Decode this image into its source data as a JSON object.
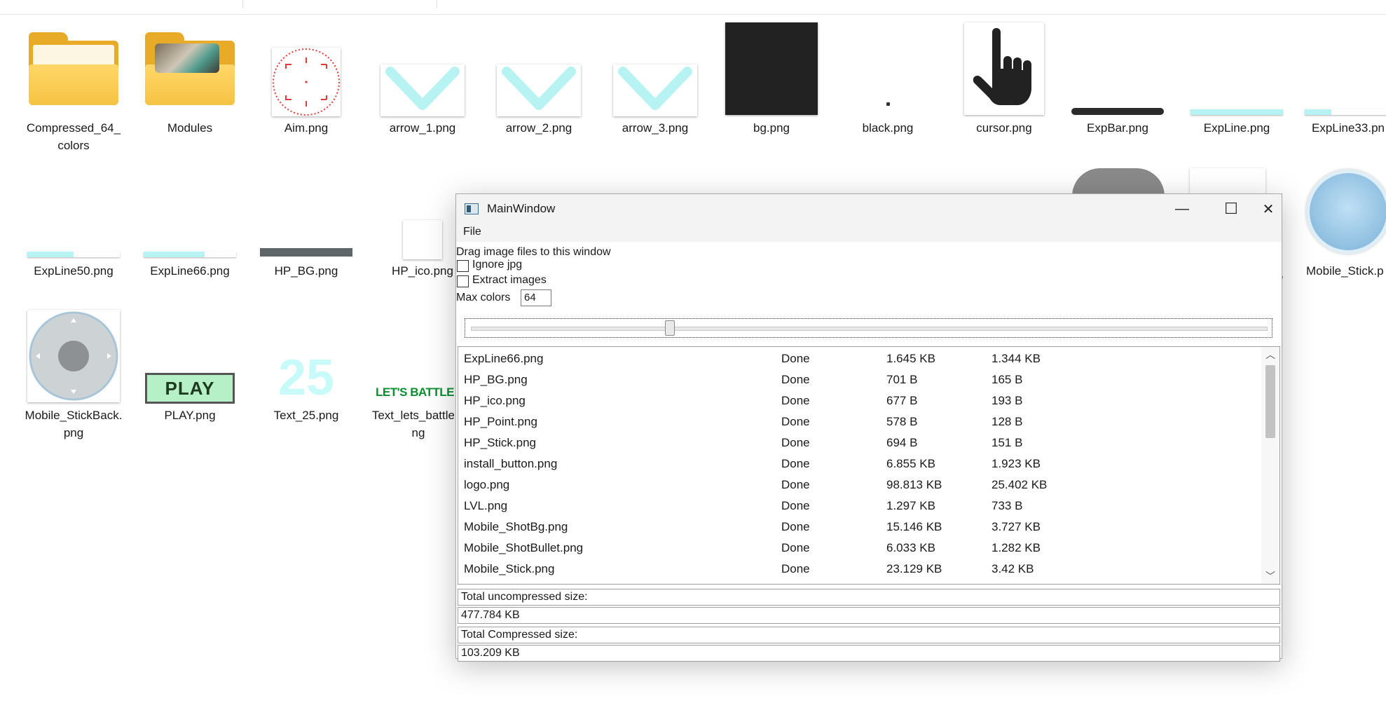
{
  "explorer": {
    "row1": [
      {
        "label": "Compressed_64_\ncolors",
        "icon": "folder-icon"
      },
      {
        "label": "Modules",
        "icon": "folder-icon"
      },
      {
        "label": "Aim.png",
        "icon": "aim-thumbnail"
      },
      {
        "label": "arrow_1.png",
        "icon": "arrow-thumbnail"
      },
      {
        "label": "arrow_2.png",
        "icon": "arrow-thumbnail"
      },
      {
        "label": "arrow_3.png",
        "icon": "arrow-thumbnail"
      },
      {
        "label": "bg.png",
        "icon": "bg-thumbnail"
      },
      {
        "label": "black.png",
        "icon": "black-thumbnail"
      },
      {
        "label": "cursor.png",
        "icon": "cursor-thumbnail"
      },
      {
        "label": "ExpBar.png",
        "icon": "expbar-thumbnail"
      },
      {
        "label": "ExpLine.png",
        "icon": "expline-thumbnail"
      },
      {
        "label": "ExpLine33.pn",
        "icon": "expline-thumbnail"
      }
    ],
    "row2": [
      {
        "label": "ExpLine50.png",
        "icon": "expline-thumbnail"
      },
      {
        "label": "ExpLine66.png",
        "icon": "expline-thumbnail"
      },
      {
        "label": "HP_BG.png",
        "icon": "hpbg-thumbnail"
      },
      {
        "label": "HP_ico.png",
        "icon": "hpico-thumbnail"
      },
      {
        "label": "Mobile_Stick.p",
        "icon": "stick-thumbnail"
      }
    ],
    "row3": [
      {
        "label": "Mobile_StickBack.\npng",
        "icon": "stickback-thumbnail"
      },
      {
        "label": "PLAY.png",
        "icon": "play-thumbnail"
      },
      {
        "label": "Text_25.png",
        "icon": "text25-thumbnail"
      },
      {
        "label": "Text_lets_battle.p\nng",
        "icon": "textbattle-thumbnail"
      }
    ],
    "thumb_text": {
      "play": "PLAY",
      "text25": "25",
      "battle": "LET'S BATTLE"
    },
    "partial_label": "e"
  },
  "window": {
    "title": "MainWindow",
    "menu": [
      "File"
    ],
    "controls": {
      "minimize": "—",
      "maximize": "☐",
      "close": "✕"
    },
    "drag_hint": "Drag image files to this window",
    "ignore_jpg_label": "Ignore jpg",
    "extract_images_label": "Extract images",
    "max_colors_label": "Max colors",
    "max_colors_value": "64",
    "slider_fraction": 0.25,
    "files": [
      {
        "name": "ExpLine66.png",
        "status": "Done",
        "original": "1.645 KB",
        "compressed": "1.344 KB"
      },
      {
        "name": "HP_BG.png",
        "status": "Done",
        "original": "701 B",
        "compressed": "165 B"
      },
      {
        "name": "HP_ico.png",
        "status": "Done",
        "original": "677 B",
        "compressed": "193 B"
      },
      {
        "name": "HP_Point.png",
        "status": "Done",
        "original": "578 B",
        "compressed": "128 B"
      },
      {
        "name": "HP_Stick.png",
        "status": "Done",
        "original": "694 B",
        "compressed": "151 B"
      },
      {
        "name": "install_button.png",
        "status": "Done",
        "original": "6.855 KB",
        "compressed": "1.923 KB"
      },
      {
        "name": "logo.png",
        "status": "Done",
        "original": "98.813 KB",
        "compressed": "25.402 KB"
      },
      {
        "name": "LVL.png",
        "status": "Done",
        "original": "1.297 KB",
        "compressed": "733 B"
      },
      {
        "name": "Mobile_ShotBg.png",
        "status": "Done",
        "original": "15.146 KB",
        "compressed": "3.727 KB"
      },
      {
        "name": "Mobile_ShotBullet.png",
        "status": "Done",
        "original": "6.033 KB",
        "compressed": "1.282 KB"
      },
      {
        "name": "Mobile_Stick.png",
        "status": "Done",
        "original": "23.129 KB",
        "compressed": "3.42 KB"
      }
    ],
    "total_uncompressed_label": "Total uncompressed size:",
    "total_uncompressed_value": "477.784 KB",
    "total_compressed_label": "Total Compressed size:",
    "total_compressed_value": "103.209 KB"
  }
}
